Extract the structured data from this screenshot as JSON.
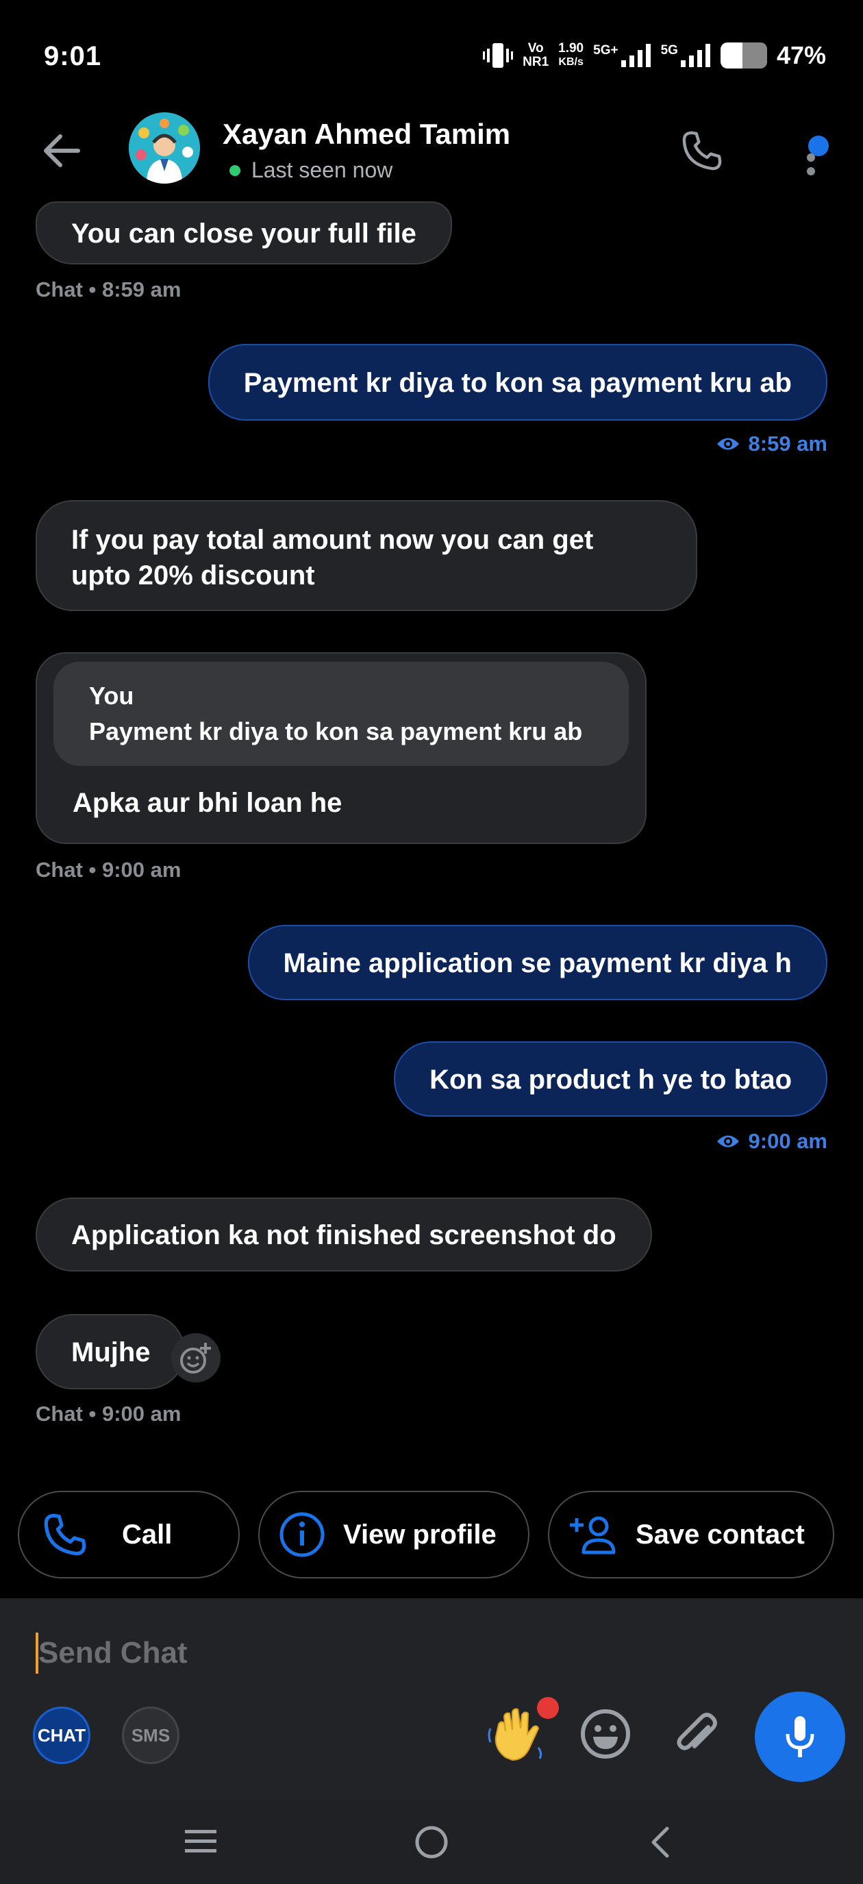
{
  "status_bar": {
    "time": "9:01",
    "net_top": "Vo",
    "net_bottom": "NR1",
    "speed_top": "1.90",
    "speed_bottom": "KB/s",
    "sim1": "5G+",
    "sim2": "5G",
    "battery_percent": "47%",
    "battery_level": 0.47
  },
  "header": {
    "contact_name": "Xayan Ahmed Tamim",
    "status": "Last seen now"
  },
  "messages": {
    "m1": "You can close your full file",
    "m1_meta": "Chat • 8:59 am",
    "m2": "Payment kr diya to kon sa payment kru ab",
    "m2_meta": "8:59 am",
    "m3_line1": "If you pay total amount now you can get",
    "m3_line2": "upto 20% discount",
    "m4_quote_author": "You",
    "m4_quote_text": "Payment kr diya to kon sa payment kru ab",
    "m4": "Apka aur bhi loan he",
    "m4_meta": "Chat • 9:00 am",
    "m5": "Maine application se payment kr diya h",
    "m6": "Kon sa product h ye to btao",
    "m6_meta": "9:00 am",
    "m7": "Application ka not finished screenshot do",
    "m8": "Mujhe",
    "m8_meta": "Chat • 9:00 am"
  },
  "quick_actions": {
    "call": "Call",
    "view_profile": "View profile",
    "save_contact": "Save contact"
  },
  "composer": {
    "placeholder": "Send Chat",
    "chat_mode": "CHAT",
    "sms_mode": "SMS"
  },
  "colors": {
    "accent": "#1a73e8",
    "outgoing_bubble": "#0b2559",
    "incoming_bubble": "#232427",
    "online": "#2ecc71"
  }
}
